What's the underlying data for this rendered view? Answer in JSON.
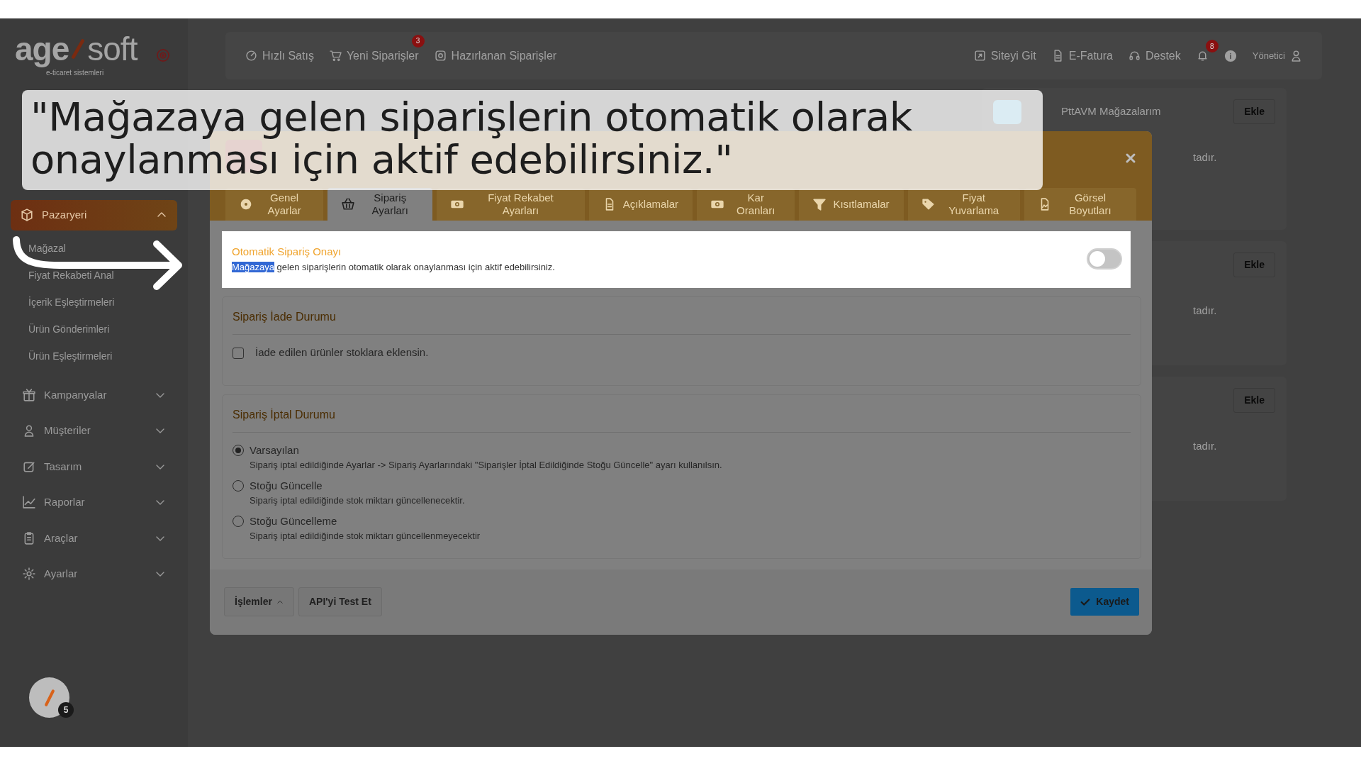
{
  "caption": "\"Mağazaya gelen siparişlerin otomatik olarak onaylanması için aktif edebilirsiniz.\"",
  "logo": {
    "left": "age",
    "right": "soft",
    "tagline": "e-ticaret sistemleri"
  },
  "sidebar": {
    "items": [
      {
        "label": "Pazaryeri",
        "selected": true,
        "expanded": true,
        "children": [
          {
            "label": "Mağazal"
          },
          {
            "label": "Fiyat Rekabeti Anal"
          },
          {
            "label": "İçerik Eşleştirmeleri"
          },
          {
            "label": "Ürün Gönderimleri"
          },
          {
            "label": "Ürün Eşleştirmeleri"
          }
        ]
      },
      {
        "label": "Kampanyalar",
        "selected": false,
        "expanded": false
      },
      {
        "label": "Müşteriler",
        "selected": false,
        "expanded": false
      },
      {
        "label": "Tasarım",
        "selected": false,
        "expanded": false
      },
      {
        "label": "Raporlar",
        "selected": false,
        "expanded": false
      },
      {
        "label": "Araçlar",
        "selected": false,
        "expanded": false
      },
      {
        "label": "Ayarlar",
        "selected": false,
        "expanded": false
      }
    ]
  },
  "header": {
    "links": [
      {
        "label": "Hızlı Satış"
      },
      {
        "label": "Yeni Siparişler",
        "badge": "3"
      },
      {
        "label": "Hazırlanan Siparişler"
      }
    ],
    "right_links": [
      {
        "label": "Siteyi Git"
      },
      {
        "label": "E-Fatura"
      },
      {
        "label": "Destek"
      }
    ],
    "notification_badge": "8",
    "user": "Yönetici"
  },
  "background_cards": [
    {
      "title": "PttAVM Mağazalarım",
      "button": "Ekle",
      "text": "tadır."
    },
    {
      "button": "Ekle",
      "text": "tadır."
    },
    {
      "button": "Ekle",
      "text": "tadır."
    }
  ],
  "modal": {
    "tabs": [
      {
        "label": "Genel Ayarlar",
        "selected": false
      },
      {
        "label": "Sipariş Ayarları",
        "selected": true
      },
      {
        "label": "Fiyat Rekabet Ayarları",
        "selected": false
      },
      {
        "label": "Açıklamalar",
        "selected": false
      },
      {
        "label": "Kar Oranları",
        "selected": false
      },
      {
        "label": "Kısıtlamalar",
        "selected": false
      },
      {
        "label": "Fiyat Yuvarlama",
        "selected": false
      },
      {
        "label": "Görsel Boyutları",
        "selected": false
      }
    ],
    "auto_approval": {
      "title": "Otomatik Sipariş Onayı",
      "on": false,
      "description_parts": [
        {
          "text": "Mağazaya",
          "selected": true
        },
        {
          "text": " gelen siparişlerin otomatik olarak onaylanması için aktif edebilirsiniz.",
          "selected": false
        }
      ]
    },
    "return_section": {
      "title": "Sipariş İade Durumu",
      "checkbox": {
        "label": "İade edilen ürünler stoklara eklensin.",
        "checked": false
      }
    },
    "cancel_section": {
      "title": "Sipariş İptal Durumu",
      "options": [
        {
          "label": "Varsayılan",
          "hint": "Sipariş iptal edildiğinde Ayarlar -> Sipariş Ayarlarındaki \"Siparişler İptal Edildiğinde Stoğu Güncelle\" ayarı kullanılsın.",
          "selected": true
        },
        {
          "label": "Stoğu Güncelle",
          "hint": "Sipariş iptal edildiğinde stok miktarı güncellenecektir.",
          "selected": false
        },
        {
          "label": "Stoğu Güncelleme",
          "hint": "Sipariş iptal edildiğinde stok miktarı güncellenmeyecektir",
          "selected": false
        }
      ]
    },
    "footer": {
      "actions_button": "İşlemler",
      "test_button": "API'yi Test Et",
      "save_button": "Kaydet"
    }
  },
  "avatar_badge": "5"
}
